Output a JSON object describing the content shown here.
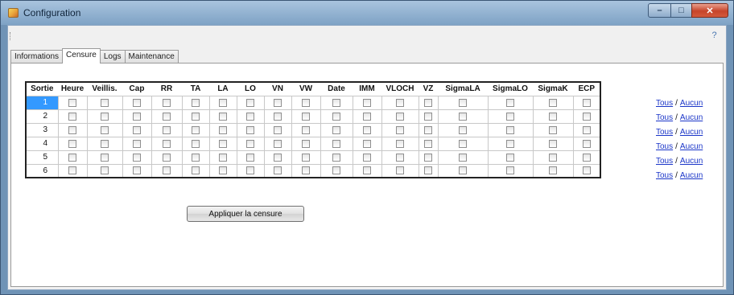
{
  "window": {
    "title": "Configuration",
    "minimize_glyph": "–",
    "maximize_glyph": "□",
    "close_glyph": "✕"
  },
  "help_glyph": "?",
  "tabs": [
    {
      "label": "Informations",
      "active": false
    },
    {
      "label": "Censure",
      "active": true
    },
    {
      "label": "Logs",
      "active": false
    },
    {
      "label": "Maintenance",
      "active": false
    }
  ],
  "grid": {
    "columns": [
      "Sortie",
      "Heure",
      "Veillis.",
      "Cap",
      "RR",
      "TA",
      "LA",
      "LO",
      "VN",
      "VW",
      "Date",
      "IMM",
      "VLOCH",
      "VZ",
      "SigmaLA",
      "SigmaLO",
      "SigmaK",
      "ECP"
    ],
    "rows": [
      "1",
      "2",
      "3",
      "4",
      "5",
      "6"
    ],
    "selected_row": 0
  },
  "row_links": {
    "all_label": "Tous",
    "separator": "/",
    "none_label": "Aucun"
  },
  "apply_button": "Appliquer la censure"
}
